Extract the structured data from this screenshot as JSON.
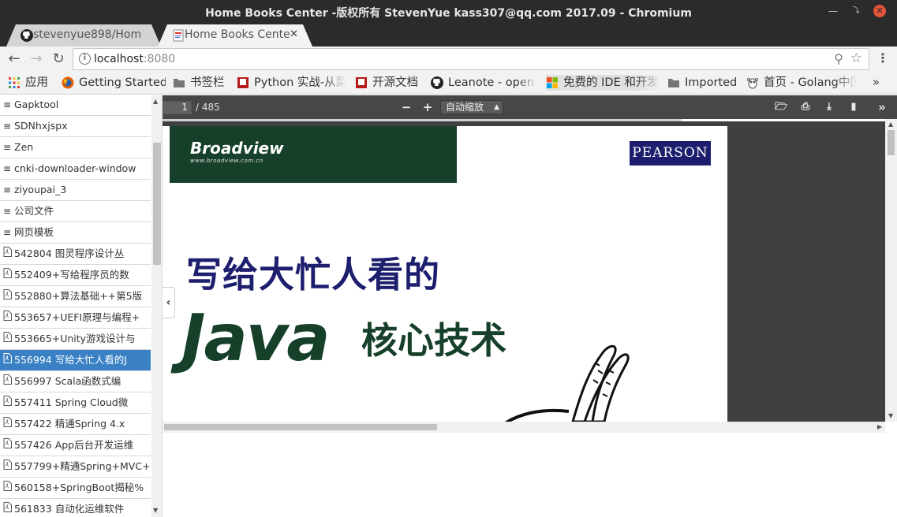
{
  "window": {
    "title": "Home Books Center -版权所有 StevenYue kass307@qq.com 2017.09 - Chromium"
  },
  "tabs": [
    {
      "label": "stevenyue898/Hom"
    },
    {
      "label": "Home Books Cente"
    }
  ],
  "omnibox": {
    "host": "localhost",
    "port": ":8080"
  },
  "bookmarks": [
    {
      "label": "应用",
      "icon": "apps-grid-icon"
    },
    {
      "label": "Getting Started",
      "icon": "firefox-icon"
    },
    {
      "label": "书签栏",
      "icon": "folder-icon"
    },
    {
      "label": "Python 实战-从菜",
      "icon": "red-square-icon"
    },
    {
      "label": "开源文档",
      "icon": "red-square-icon"
    },
    {
      "label": "Leanote - open s",
      "icon": "github-icon"
    },
    {
      "label": "免费的 IDE 和开发",
      "icon": "microsoft-icon"
    },
    {
      "label": "Imported",
      "icon": "folder-icon"
    },
    {
      "label": "首页 - Golang中国",
      "icon": "gopher-icon"
    }
  ],
  "sidebar": {
    "items": [
      {
        "label": "Gapktool",
        "type": "folder"
      },
      {
        "label": "SDNhxjspx",
        "type": "folder"
      },
      {
        "label": "Zen",
        "type": "folder"
      },
      {
        "label": "cnki-downloader-window",
        "type": "folder"
      },
      {
        "label": "ziyoupai_3",
        "type": "folder"
      },
      {
        "label": "公司文件",
        "type": "folder"
      },
      {
        "label": "网页模板",
        "type": "folder"
      },
      {
        "label": "542804 图灵程序设计丛",
        "type": "pdf"
      },
      {
        "label": "552409+写给程序员的数",
        "type": "pdf"
      },
      {
        "label": "552880+算法基础++第5版",
        "type": "pdf"
      },
      {
        "label": "553657+UEFI原理与编程+",
        "type": "pdf"
      },
      {
        "label": "553665+Unity游戏设计与",
        "type": "pdf"
      },
      {
        "label": "556994 写给大忙人看的J",
        "type": "pdf",
        "selected": true
      },
      {
        "label": "556997 Scala函数式编",
        "type": "pdf"
      },
      {
        "label": "557411 Spring Cloud微",
        "type": "pdf"
      },
      {
        "label": "557422 精通Spring 4.x",
        "type": "pdf"
      },
      {
        "label": "557426 App后台开发运维",
        "type": "pdf"
      },
      {
        "label": "557799+精通Spring+MVC+",
        "type": "pdf"
      },
      {
        "label": "560158+SpringBoot揭秘%",
        "type": "pdf"
      },
      {
        "label": "561833 自动化运维软件",
        "type": "pdf"
      }
    ]
  },
  "pdf": {
    "page_current": "1",
    "page_total": "/ 485",
    "zoom": "自动缩放",
    "cover": {
      "publisher": "Broadview",
      "publisher_url": "www.broadview.com.cn",
      "brand": "PEARSON",
      "title_line1": "写给大忙人看的",
      "title_java": "Java",
      "title_line2": "核心技术"
    }
  }
}
